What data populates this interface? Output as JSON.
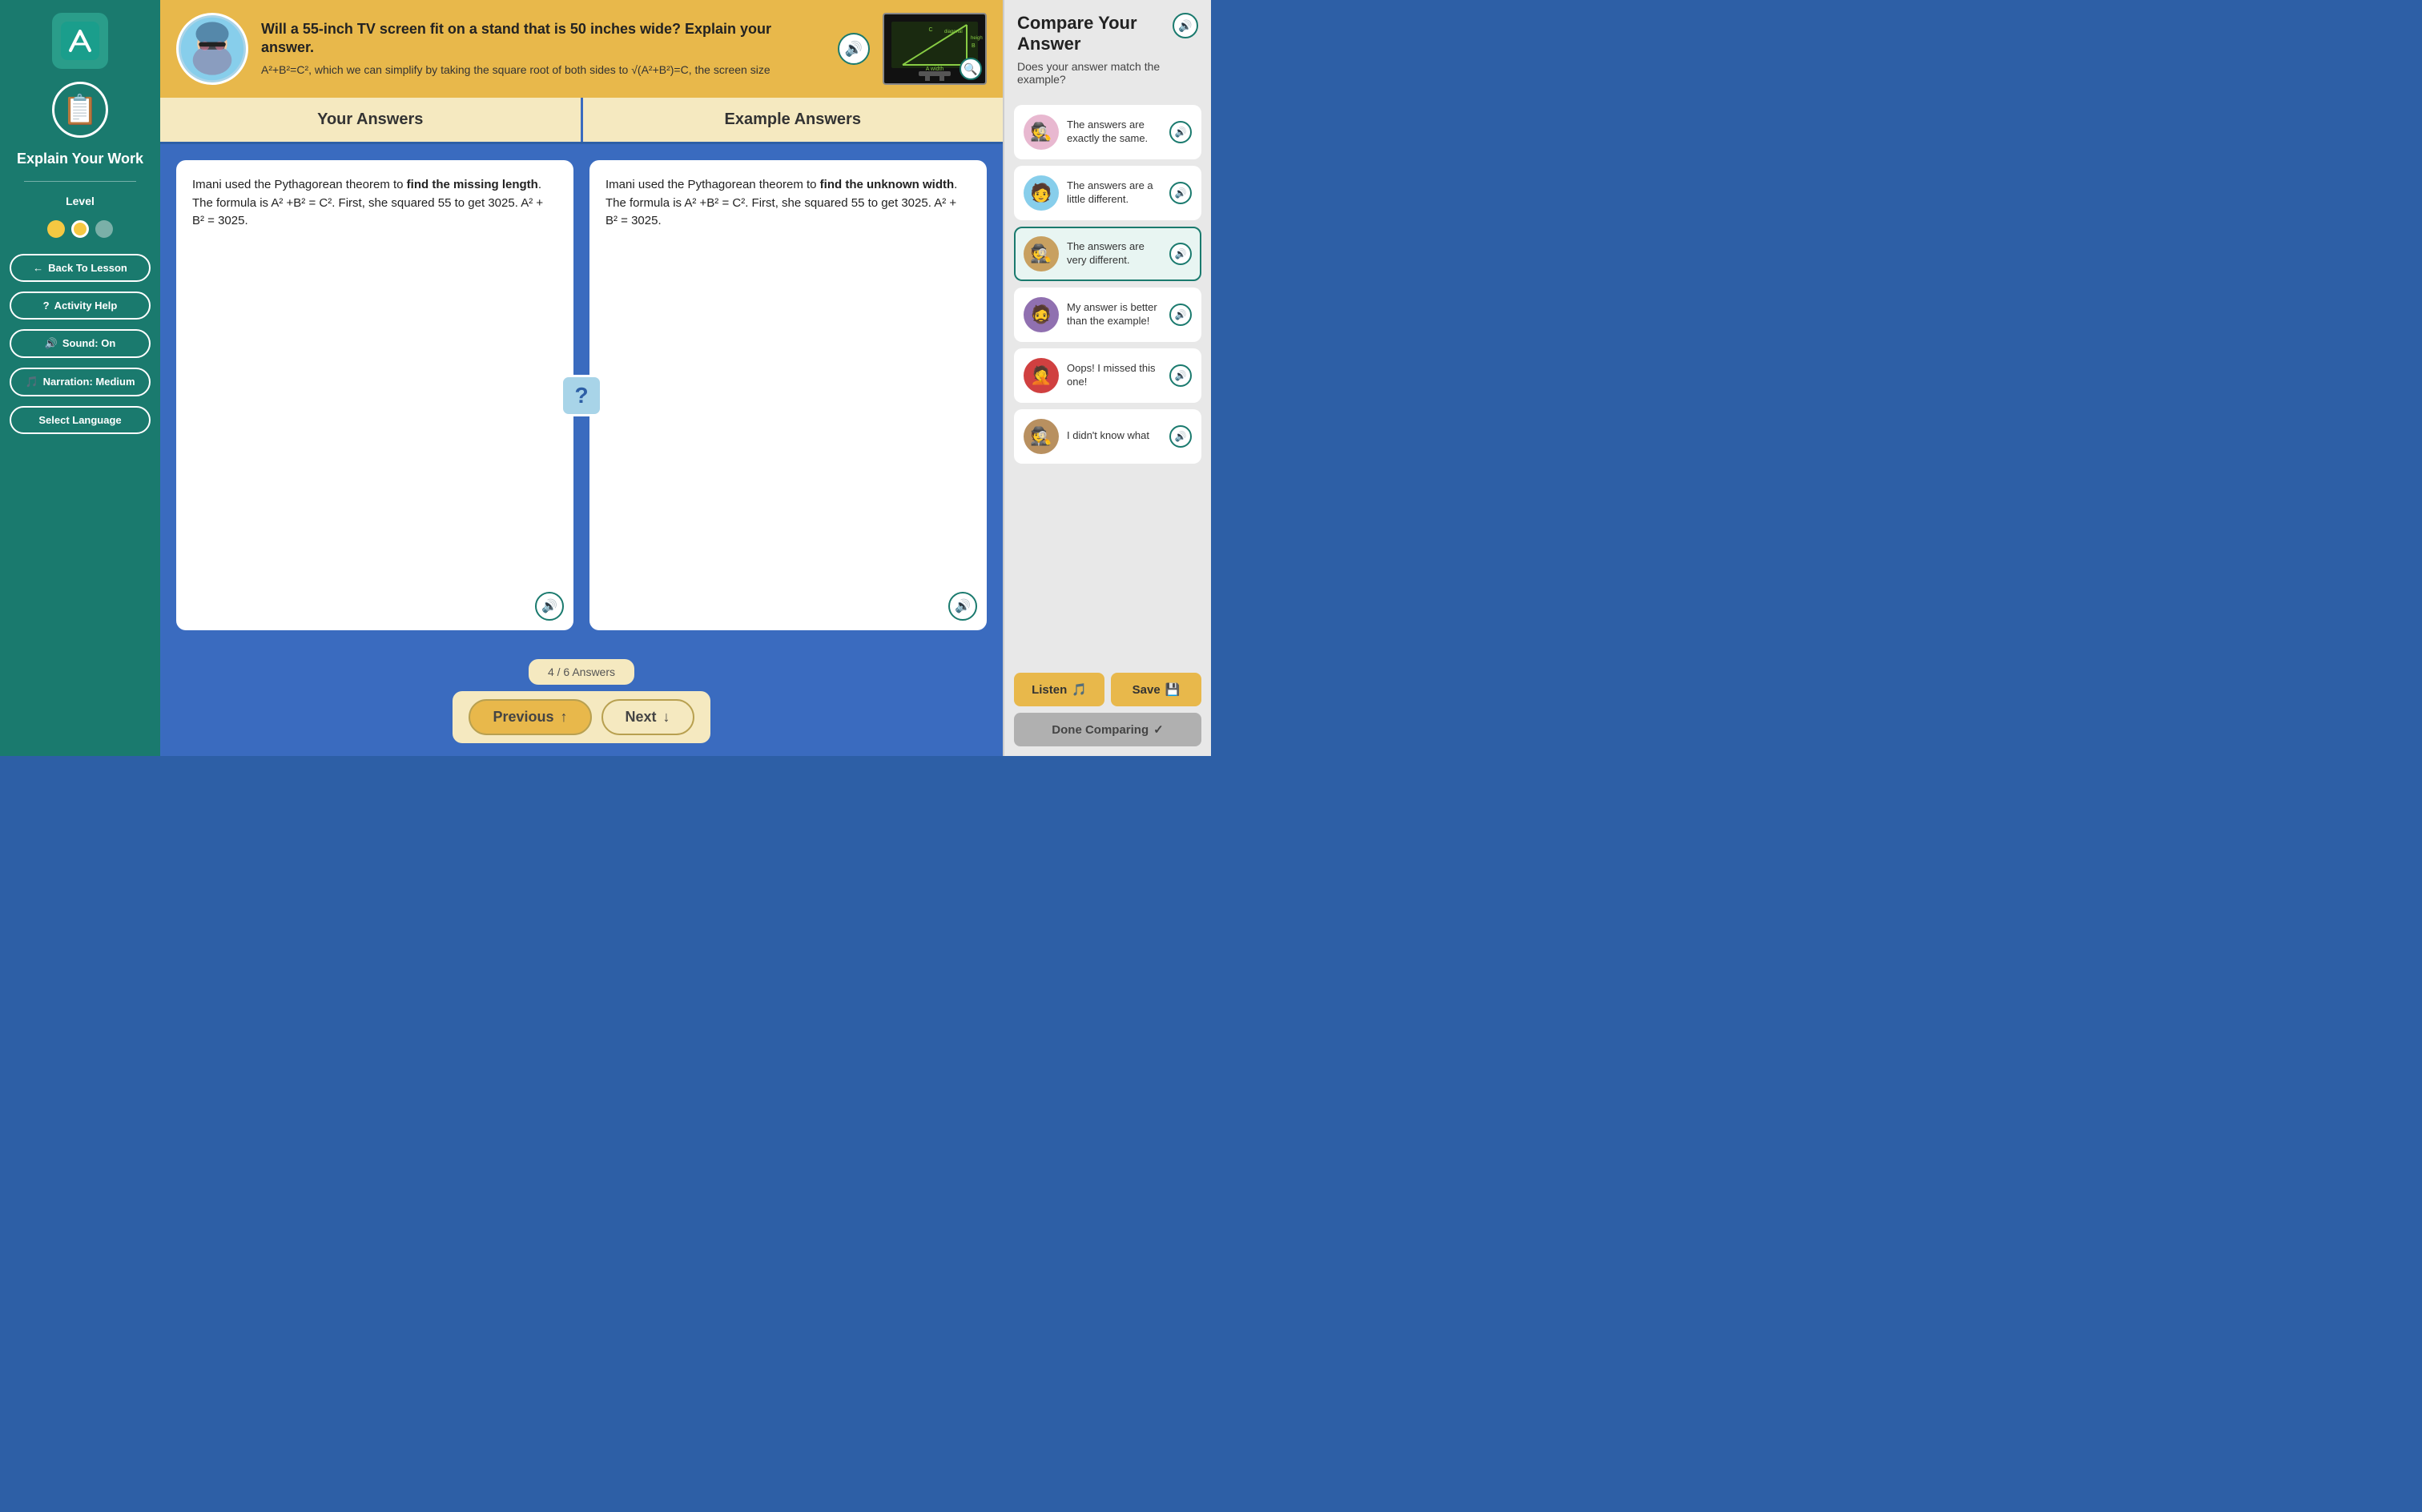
{
  "sidebar": {
    "title": "Explain Your Work",
    "level_label": "Level",
    "back_to_lesson": "Back To Lesson",
    "activity_help": "Activity Help",
    "sound": "Sound: On",
    "narration": "Narration: Medium",
    "select_language": "Select Language",
    "dots": [
      {
        "type": "yellow",
        "active": false
      },
      {
        "type": "yellow",
        "active": true
      },
      {
        "type": "gray",
        "active": false
      }
    ]
  },
  "question": {
    "title": "Will a 55-inch TV screen fit on a stand that is 50 inches wide? Explain your answer.",
    "body": "A²+B²=C², which we can simplify by taking the square root of both sides to √(A²+B²)=C, the screen size"
  },
  "answers": {
    "your_answers_label": "Your Answers",
    "example_answers_label": "Example Answers",
    "your_answer_text": "Imani used the Pythagorean theorem to find the missing length. The formula is A² +B² = C². First, she squared 55 to get 3025. A² + B² = 3025.",
    "example_answer_text": "Imani used the Pythagorean theorem to find the unknown width. The formula is A² +B² = C². First, she squared 55 to get 3025. A² + B² = 3025.",
    "your_answer_bold": "find the missing length",
    "example_answer_bold": "find the unknown width",
    "compare_icon": "?"
  },
  "navigation": {
    "counter": "4 / 6 Answers",
    "previous_label": "Previous",
    "next_label": "Next",
    "previous_icon": "↑",
    "next_icon": "↓"
  },
  "right_panel": {
    "title": "Compare Your Answer",
    "subtitle": "Does your answer match the example?",
    "listen_label": "Listen",
    "save_label": "Save",
    "done_label": "Done Comparing",
    "options": [
      {
        "id": "exactly",
        "text": "The answers are exactly the same.",
        "avatar_emoji": "🕵️"
      },
      {
        "id": "little-different",
        "text": "The answers are a little different.",
        "avatar_emoji": "🧑"
      },
      {
        "id": "very-different",
        "text": "The answers are very different.",
        "avatar_emoji": "🕵️",
        "selected": true
      },
      {
        "id": "better",
        "text": "My answer is better than the example!",
        "avatar_emoji": "🧔"
      },
      {
        "id": "missed",
        "text": "Oops! I missed this one!",
        "avatar_emoji": "🤦"
      },
      {
        "id": "didnt-know",
        "text": "I didn't know what",
        "avatar_emoji": "🕵️"
      }
    ]
  }
}
